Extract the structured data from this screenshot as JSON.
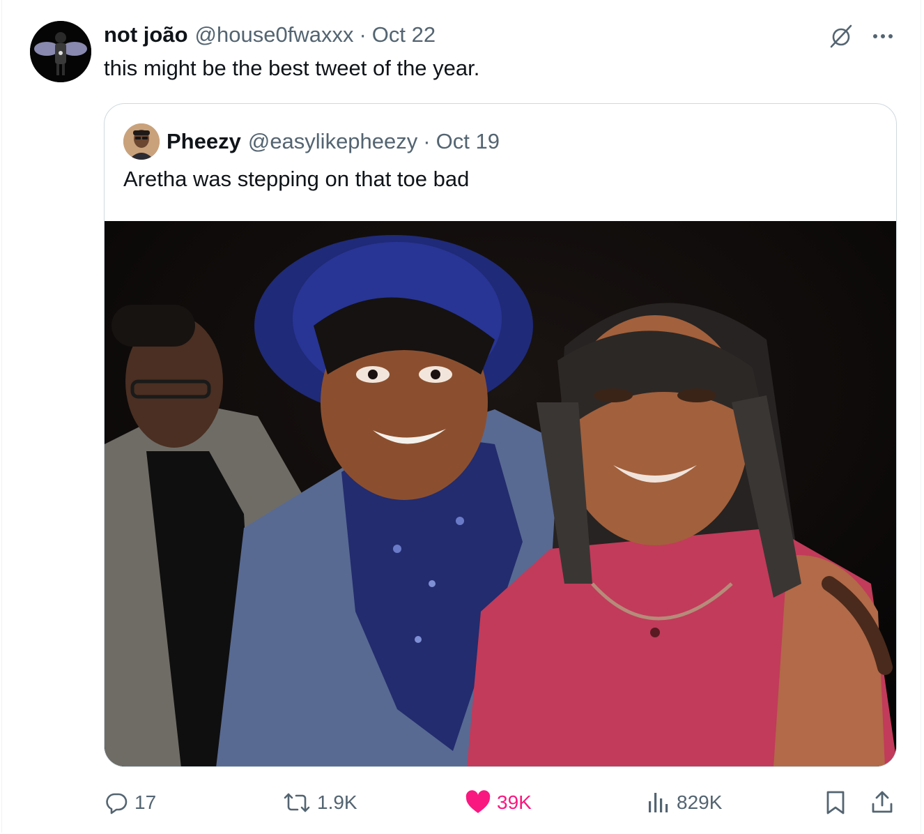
{
  "tweet": {
    "display_name": "not joão",
    "handle": "@house0fwaxxx",
    "separator": "·",
    "date": "Oct 22",
    "text": "this might be the best tweet of the year."
  },
  "quoted_tweet": {
    "display_name": "Pheezy",
    "handle": "@easylikepheezy",
    "separator": "·",
    "date": "Oct 19",
    "text": "Aretha was stepping on that toe bad",
    "media": "photo"
  },
  "actions": {
    "replies": "17",
    "reposts": "1.9K",
    "likes": "39K",
    "views": "829K"
  },
  "icons": {
    "grok": "grok-icon",
    "more": "more-icon",
    "reply": "reply-icon",
    "repost": "repost-icon",
    "like": "heart-icon",
    "views": "views-icon",
    "bookmark": "bookmark-icon",
    "share": "share-icon"
  },
  "colors": {
    "text": "#0f1419",
    "muted": "#536471",
    "border": "#cfd9de",
    "like": "#f91880"
  }
}
